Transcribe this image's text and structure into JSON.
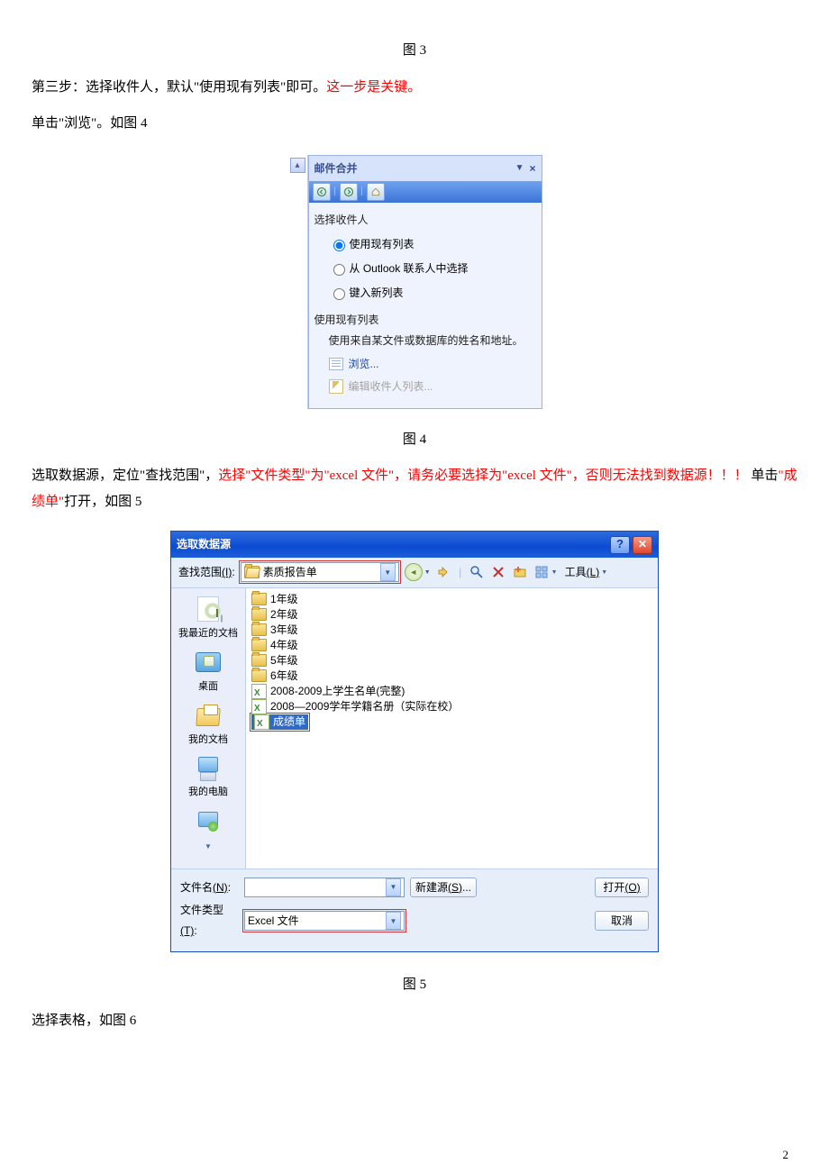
{
  "fig3_caption": "图 3",
  "para1_a": "第三步：选择收件人，默认\"使用现有列表\"即可。",
  "para1_b": "这一步是关键。",
  "para2": "单击\"浏览\"。如图 4",
  "mail_merge": {
    "title": "邮件合并",
    "section1": "选择收件人",
    "opt_existing": "使用现有列表",
    "opt_outlook": "从 Outlook 联系人中选择",
    "opt_new": "键入新列表",
    "section2": "使用现有列表",
    "desc": "使用来自某文件或数据库的姓名和地址。",
    "browse": "浏览...",
    "edit": "编辑收件人列表..."
  },
  "fig4_caption": "图 4",
  "para3_a": "选取数据源，定位\"查找范围\"，",
  "para3_b": "选择\"文件类型\"为\"excel 文件\"，请务必要选择为\"excel 文件\"，否则无法找到数据源！！！",
  "para3_c": " 单击",
  "para3_d": "\"成绩单\"",
  "para3_e": "打开，如图 5",
  "dialog": {
    "title": "选取数据源",
    "lookin_label": "查找范围",
    "lookin_key": "(I)",
    "lookin_value": "素质报告单",
    "tools_label": "工具",
    "tools_key": "(L)",
    "places": {
      "recent": "我最近的文档",
      "desktop": "桌面",
      "mydocs": "我的文档",
      "mypc": "我的电脑"
    },
    "items": {
      "g1": "1年级",
      "g2": "2年级",
      "g3": "3年级",
      "g4": "4年级",
      "g5": "5年级",
      "g6": "6年级",
      "xls1": "2008-2009上学生名单(完整)",
      "xls2": "2008—2009学年学籍名册（实际在校）",
      "xls3": "成绩单"
    },
    "filename_label": "文件名",
    "filename_key": "(N)",
    "filetype_label": "文件类型",
    "filetype_key": "(T)",
    "filetype_value": "Excel 文件",
    "btn_newsrc": "新建源",
    "btn_newsrc_key": "(S)",
    "btn_open": "打开",
    "btn_open_key": "(O)",
    "btn_cancel": "取消"
  },
  "fig5_caption": "图 5",
  "para4": "选择表格，如图 6",
  "page_number": "2"
}
